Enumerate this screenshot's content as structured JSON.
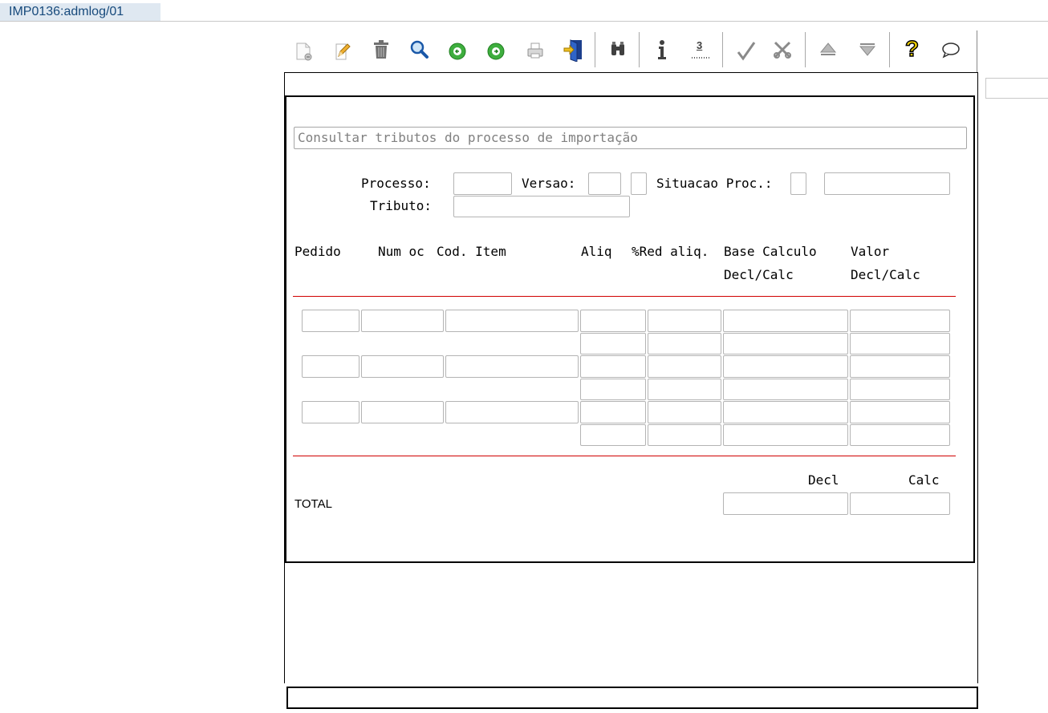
{
  "tab": {
    "title": "IMP0136:admlog/01"
  },
  "toolbar": {
    "buttons": [
      {
        "icon": "new-document-icon"
      },
      {
        "icon": "edit-icon"
      },
      {
        "icon": "trash-icon"
      },
      {
        "icon": "search-icon"
      },
      {
        "icon": "previous-icon"
      },
      {
        "icon": "next-icon"
      },
      {
        "icon": "print-icon"
      },
      {
        "icon": "exit-icon"
      },
      {
        "icon": "binoculars-icon"
      },
      {
        "icon": "info-icon"
      },
      {
        "icon": "list-icon"
      },
      {
        "icon": "checkmark-icon"
      },
      {
        "icon": "cancel-icon"
      },
      {
        "icon": "up-icon"
      },
      {
        "icon": "down-icon"
      },
      {
        "icon": "help-icon"
      },
      {
        "icon": "comment-icon"
      }
    ],
    "list_digit": "3"
  },
  "form": {
    "title": "Consultar tributos do processo de importação",
    "labels": {
      "processo": "Processo:",
      "versao": "Versao:",
      "situacao": "Situacao Proc.:",
      "tributo": "Tributo:"
    },
    "fields": {
      "processo": "",
      "versao": "",
      "versao_flag": "",
      "situacao_code": "",
      "situacao_desc": "",
      "tributo": ""
    }
  },
  "grid": {
    "headers": {
      "pedido": "Pedido",
      "num_oc": "Num oc",
      "cod_item": "Cod. Item",
      "aliq": "Aliq",
      "red_aliq": "%Red aliq.",
      "base_calculo": "Base Calculo",
      "base_sub": "Decl/Calc",
      "valor": "Valor",
      "valor_sub": "Decl/Calc"
    },
    "rows": [
      {
        "pedido": "",
        "num_oc": "",
        "cod_item": "",
        "aliq_decl": "",
        "aliq_calc": "",
        "red_decl": "",
        "red_calc": "",
        "base_decl": "",
        "base_calc": "",
        "valor_decl": "",
        "valor_calc": ""
      },
      {
        "pedido": "",
        "num_oc": "",
        "cod_item": "",
        "aliq_decl": "",
        "aliq_calc": "",
        "red_decl": "",
        "red_calc": "",
        "base_decl": "",
        "base_calc": "",
        "valor_decl": "",
        "valor_calc": ""
      },
      {
        "pedido": "",
        "num_oc": "",
        "cod_item": "",
        "aliq_decl": "",
        "aliq_calc": "",
        "red_decl": "",
        "red_calc": "",
        "base_decl": "",
        "base_calc": "",
        "valor_decl": "",
        "valor_calc": ""
      }
    ]
  },
  "totals": {
    "label": "TOTAL",
    "decl_label": "Decl",
    "calc_label": "Calc",
    "decl": "",
    "calc": ""
  },
  "colors": {
    "separator": "#d00000",
    "tab_bg": "#dfe8f1",
    "tab_text": "#174a7c",
    "field_border": "#b4b4b4"
  }
}
